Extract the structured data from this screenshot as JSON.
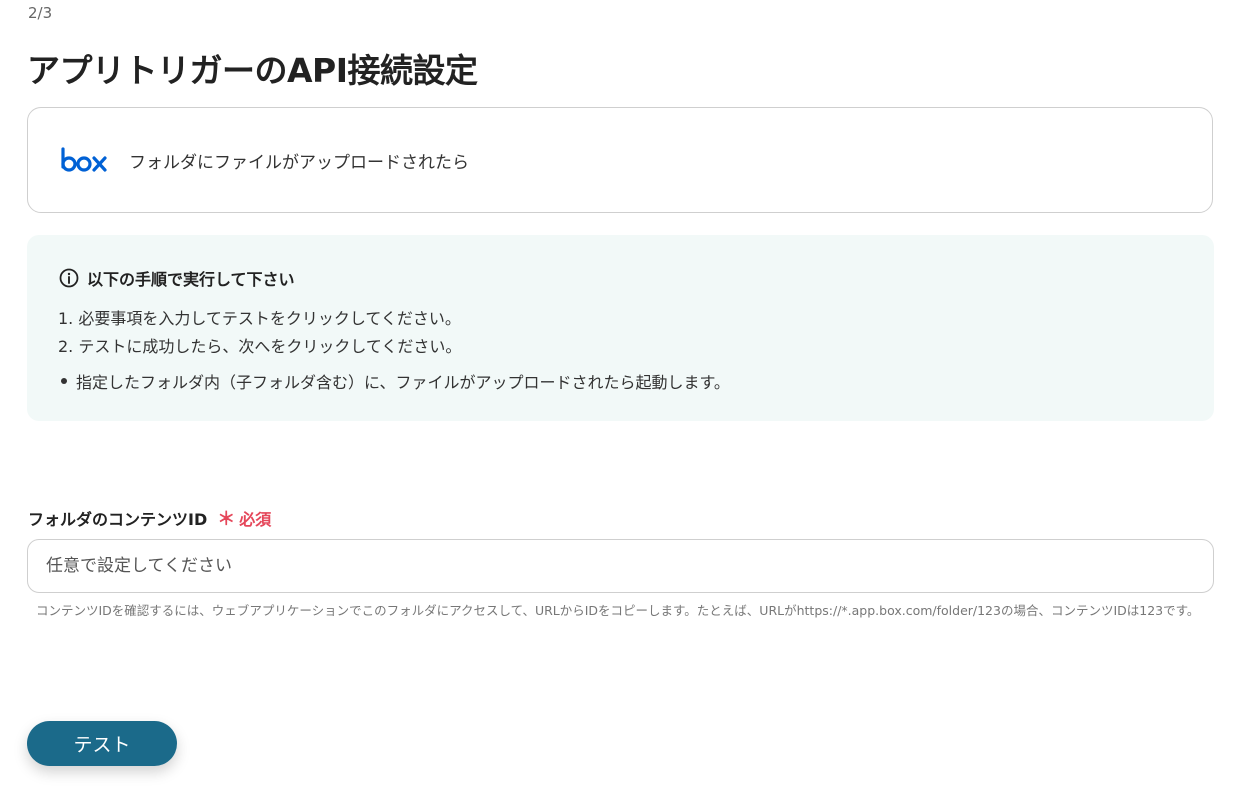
{
  "header": {
    "step": "2/3",
    "title": "アプリトリガーのAPI接続設定"
  },
  "trigger": {
    "app_icon": "box-logo",
    "label": "フォルダにファイルがアップロードされたら"
  },
  "instructions": {
    "icon": "info-icon",
    "heading": "以下の手順で実行して下さい",
    "steps": [
      "1. 必要事項を入力してテストをクリックしてください。",
      "2. テストに成功したら、次へをクリックしてください。"
    ],
    "notes": [
      "指定したフォルダ内（子フォルダ含む）に、ファイルがアップロードされたら起動します。"
    ]
  },
  "folder_field": {
    "label": "フォルダのコンテンツID",
    "required_mark": "＊",
    "required_text": "必須",
    "value": "",
    "placeholder": "任意で設定してください",
    "help": "コンテンツIDを確認するには、ウェブアプリケーションでこのフォルダにアクセスして、URLからIDをコピーします。たとえば、URLがhttps://*.app.box.com/folder/123の場合、コンテンツIDは123です。"
  },
  "actions": {
    "test_label": "テスト"
  },
  "colors": {
    "box_brand": "#0061d5",
    "primary_button": "#1b6a8a",
    "required": "#e5475a",
    "info_panel_bg": "#f2f9f8"
  }
}
